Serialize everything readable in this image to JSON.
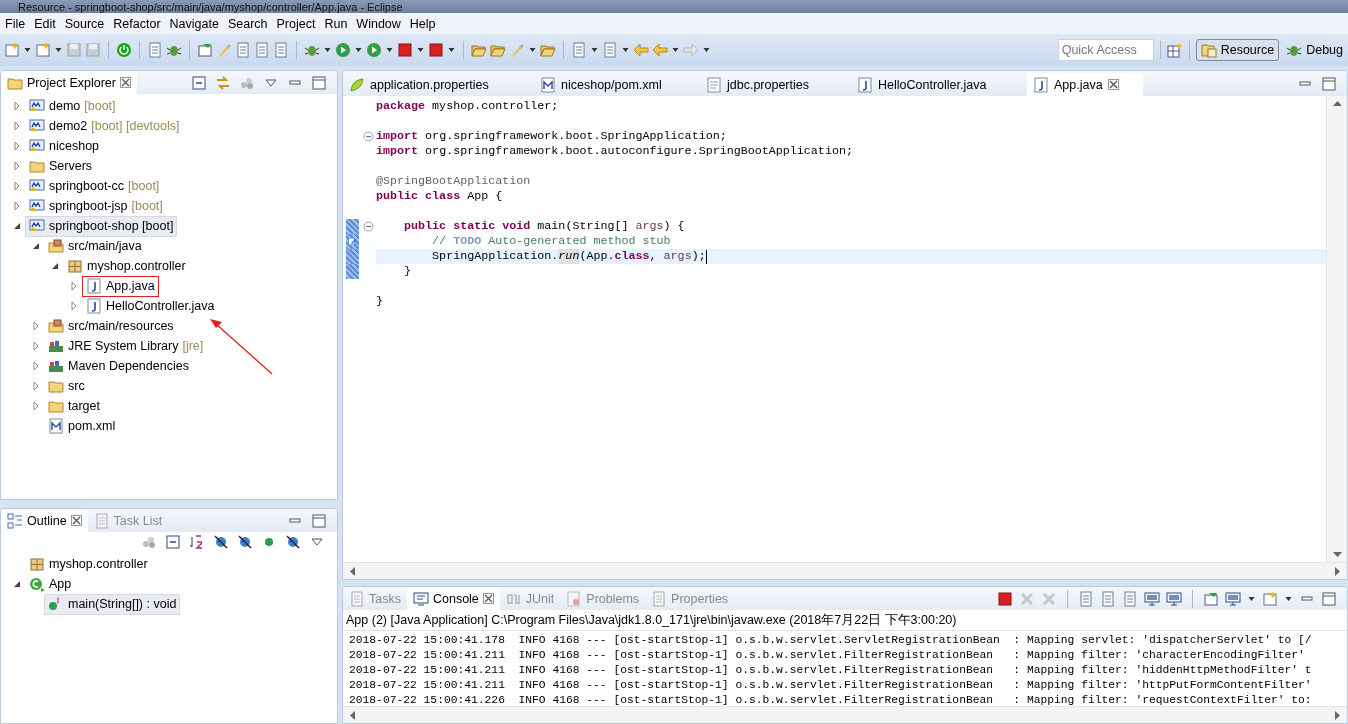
{
  "window": {
    "title": "Resource - springboot-shop/src/main/java/myshop/controller/App.java - Eclipse"
  },
  "menu": [
    "File",
    "Edit",
    "Source",
    "Refactor",
    "Navigate",
    "Search",
    "Project",
    "Run",
    "Window",
    "Help"
  ],
  "quick_access": {
    "placeholder": "Quick Access"
  },
  "perspectives": [
    {
      "label": "Resource",
      "selected": true
    },
    {
      "label": "Debug",
      "selected": false
    }
  ],
  "project_explorer": {
    "title": "Project Explorer",
    "items": [
      {
        "label": "demo",
        "suffix": "[boot]",
        "kind": "project",
        "expanded": false,
        "selected": false
      },
      {
        "label": "demo2",
        "suffix": "[boot] [devtools]",
        "kind": "project",
        "expanded": false,
        "selected": false
      },
      {
        "label": "niceshop",
        "kind": "project",
        "expanded": false,
        "selected": false
      },
      {
        "label": "Servers",
        "kind": "folder",
        "expanded": false,
        "selected": false
      },
      {
        "label": "springboot-cc",
        "suffix": "[boot]",
        "kind": "project",
        "expanded": false,
        "selected": false
      },
      {
        "label": "springboot-jsp",
        "suffix": "[boot]",
        "kind": "project",
        "expanded": false,
        "selected": false
      },
      {
        "label": "springboot-shop [boot]",
        "kind": "project",
        "expanded": true,
        "selected": true,
        "children": [
          {
            "label": "src/main/java",
            "kind": "sourcefolder",
            "expanded": true,
            "selected": false,
            "children": [
              {
                "label": "myshop.controller",
                "kind": "package",
                "expanded": true,
                "selected": false,
                "children": [
                  {
                    "label": "App.java",
                    "kind": "java",
                    "expanded": false,
                    "selected": false,
                    "highlighted": true
                  },
                  {
                    "label": "HelloController.java",
                    "kind": "java",
                    "expanded": false,
                    "selected": false
                  }
                ]
              }
            ]
          },
          {
            "label": "src/main/resources",
            "kind": "sourcefolder",
            "expanded": false,
            "selected": false
          },
          {
            "label": "JRE System Library",
            "suffix": "[jre]",
            "kind": "library",
            "expanded": false,
            "selected": false
          },
          {
            "label": "Maven Dependencies",
            "kind": "library",
            "expanded": false,
            "selected": false
          },
          {
            "label": "src",
            "kind": "folder",
            "expanded": false,
            "selected": false
          },
          {
            "label": "target",
            "kind": "folder",
            "expanded": false,
            "selected": false
          },
          {
            "label": "pom.xml",
            "kind": "xml",
            "selected": false
          }
        ]
      }
    ]
  },
  "outline_views": [
    {
      "label": "Outline",
      "selected": true
    },
    {
      "label": "Task List",
      "selected": false
    }
  ],
  "outline": [
    {
      "label": "myshop.controller",
      "kind": "package",
      "selected": false
    },
    {
      "label": "App",
      "kind": "class",
      "expanded": true,
      "selected": false,
      "children": [
        {
          "label": "main(String[]) : void",
          "kind": "method",
          "selected": true
        }
      ]
    }
  ],
  "editor_tabs": [
    {
      "label": "application.properties",
      "kind": "properties",
      "selected": false
    },
    {
      "label": "niceshop/pom.xml",
      "kind": "xml",
      "selected": false
    },
    {
      "label": "jdbc.properties",
      "kind": "text",
      "selected": false
    },
    {
      "label": "HelloController.java",
      "kind": "java",
      "selected": false
    },
    {
      "label": "App.java",
      "kind": "java",
      "selected": true
    }
  ],
  "code_lines": [
    {
      "tokens": [
        {
          "t": "package ",
          "kind": "keyword"
        },
        {
          "t": "myshop.controller;",
          "kind": "plain"
        }
      ]
    },
    {
      "kind": "blank"
    },
    {
      "fold": true,
      "tokens": [
        {
          "t": "import ",
          "kind": "keyword"
        },
        {
          "t": "org.springframework.boot.SpringApplication;",
          "kind": "plain"
        }
      ]
    },
    {
      "tokens": [
        {
          "t": "import ",
          "kind": "keyword"
        },
        {
          "t": "org.springframework.boot.autoconfigure.SpringBootApplication;",
          "kind": "plain"
        }
      ]
    },
    {
      "kind": "blank"
    },
    {
      "tokens": [
        {
          "t": "@SpringBootApplication",
          "kind": "annotation"
        }
      ]
    },
    {
      "tokens": [
        {
          "t": "public class ",
          "kind": "keyword"
        },
        {
          "t": "App {",
          "kind": "plain"
        }
      ]
    },
    {
      "kind": "blank"
    },
    {
      "fold": true,
      "changed": true,
      "tokens": [
        {
          "t": "    public static void ",
          "kind": "keyword"
        },
        {
          "t": "main(String[] ",
          "kind": "plain"
        },
        {
          "t": "args",
          "kind": "variable"
        },
        {
          "t": ") {",
          "kind": "plain"
        }
      ]
    },
    {
      "changed": true,
      "task": true,
      "tokens": [
        {
          "t": "        // ",
          "kind": "comment"
        },
        {
          "t": "TODO",
          "kind": "tasktag"
        },
        {
          "t": " Auto-generated method stub",
          "kind": "comment"
        }
      ]
    },
    {
      "changed": true,
      "current": true,
      "tokens": [
        {
          "t": "        SpringApplication.",
          "kind": "plain"
        },
        {
          "t": "run",
          "kind": "static"
        },
        {
          "t": "(App.",
          "kind": "plain"
        },
        {
          "t": "class",
          "kind": "keyword"
        },
        {
          "t": ", ",
          "kind": "plain"
        },
        {
          "t": "args",
          "kind": "variable"
        },
        {
          "t": ");",
          "kind": "plain"
        }
      ]
    },
    {
      "changed": true,
      "tokens": [
        {
          "t": "    }",
          "kind": "plain"
        }
      ]
    },
    {
      "kind": "blank"
    },
    {
      "tokens": [
        {
          "t": "}",
          "kind": "plain"
        }
      ]
    }
  ],
  "bottom_tabs": [
    {
      "label": "Tasks",
      "selected": false
    },
    {
      "label": "Console",
      "selected": true
    },
    {
      "label": "JUnit",
      "selected": false
    },
    {
      "label": "Problems",
      "selected": false
    },
    {
      "label": "Properties",
      "selected": false
    }
  ],
  "console": {
    "header": "App (2) [Java Application] C:\\Program Files\\Java\\jdk1.8.0_171\\jre\\bin\\javaw.exe (2018年7月22日 下午3:00:20)",
    "lines": [
      "2018-07-22 15:00:41.178  INFO 4168 --- [ost-startStop-1] o.s.b.w.servlet.ServletRegistrationBean  : Mapping servlet: 'dispatcherServlet' to [/",
      "2018-07-22 15:00:41.211  INFO 4168 --- [ost-startStop-1] o.s.b.w.servlet.FilterRegistrationBean   : Mapping filter: 'characterEncodingFilter'",
      "2018-07-22 15:00:41.211  INFO 4168 --- [ost-startStop-1] o.s.b.w.servlet.FilterRegistrationBean   : Mapping filter: 'hiddenHttpMethodFilter' t",
      "2018-07-22 15:00:41.211  INFO 4168 --- [ost-startStop-1] o.s.b.w.servlet.FilterRegistrationBean   : Mapping filter: 'httpPutFormContentFilter'",
      "2018-07-22 15:00:41.226  INFO 4168 --- [ost-startStop-1] o.s.b.w.servlet.FilterRegistrationBean   : Mapping filter: 'requestContextFilter' to:"
    ]
  }
}
